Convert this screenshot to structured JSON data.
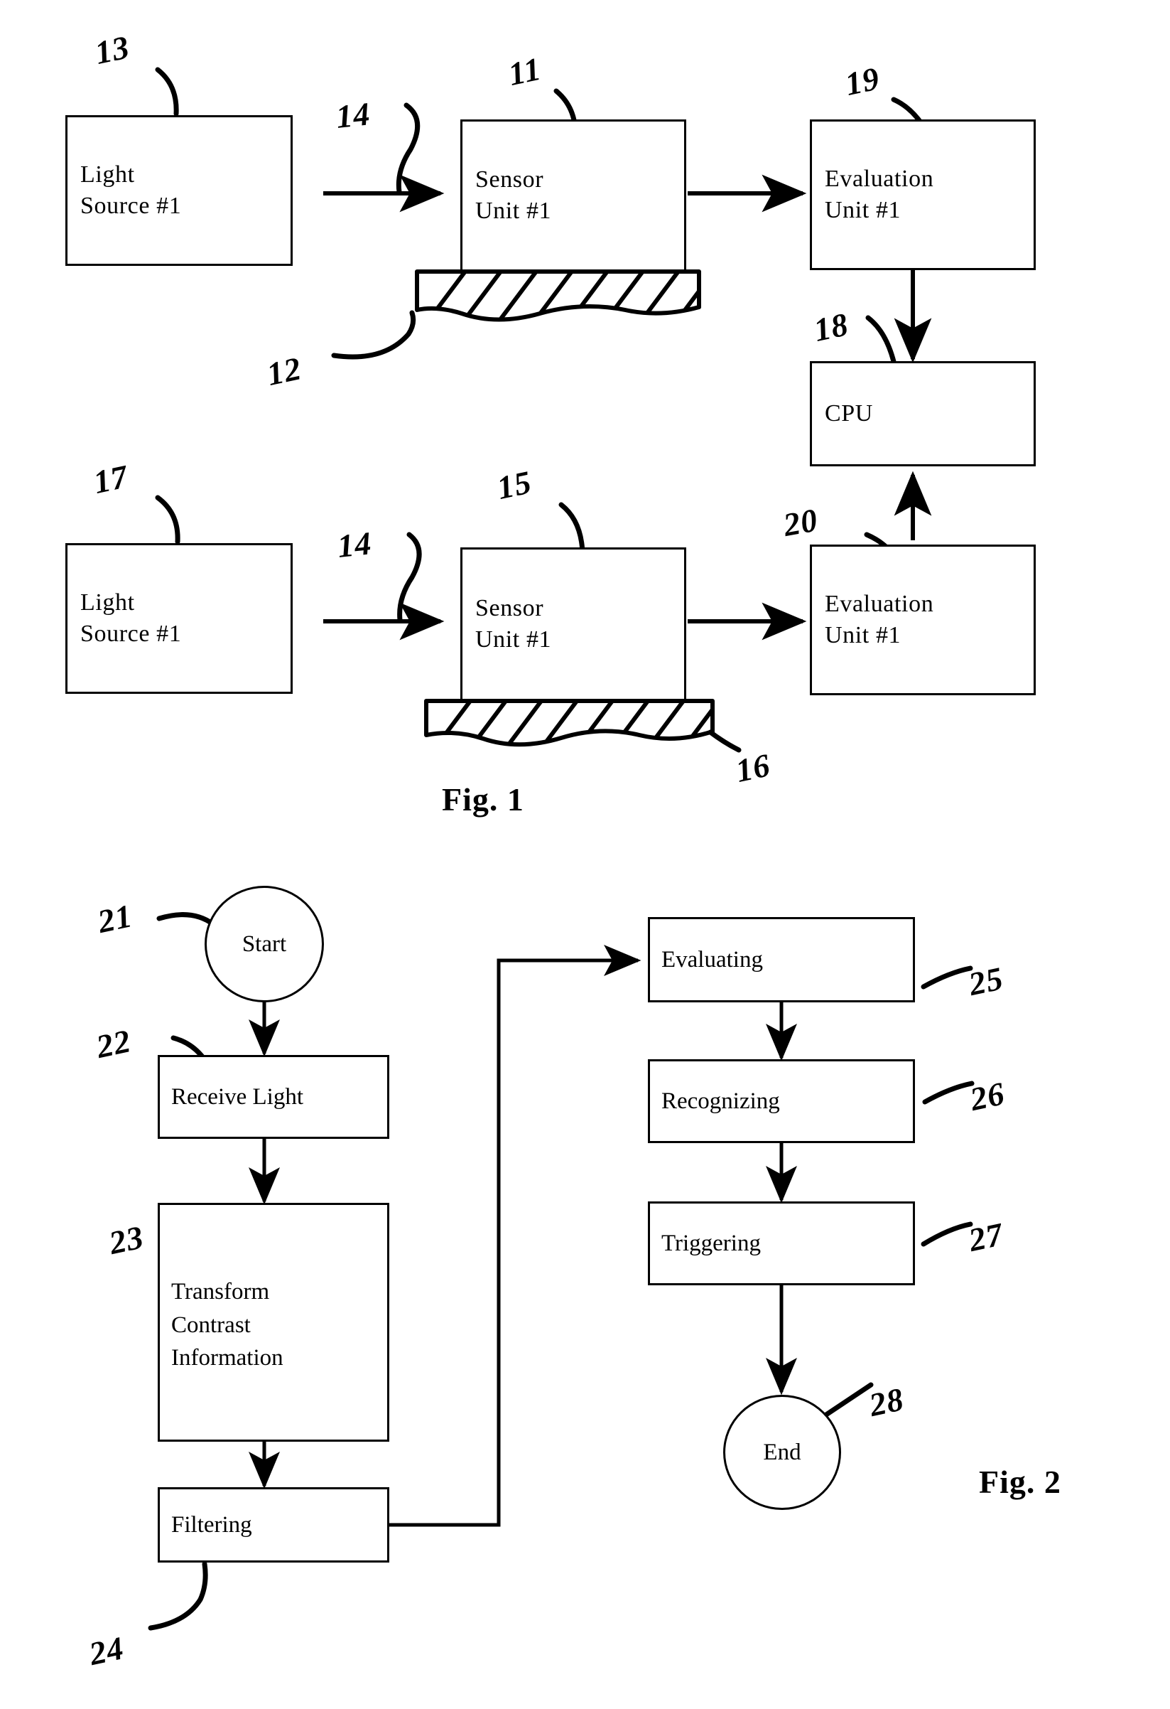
{
  "figure1": {
    "caption": "Fig. 1",
    "blocks": [
      {
        "id": "light-source-1",
        "lines": [
          "Light",
          "Source #1"
        ],
        "ref": "13"
      },
      {
        "id": "sensor-unit-1",
        "lines": [
          "Sensor",
          "Unit #1"
        ],
        "ref": "11"
      },
      {
        "id": "evaluation-unit-1",
        "lines": [
          "Evaluation",
          "Unit #1"
        ],
        "ref": "19"
      },
      {
        "id": "cpu",
        "lines": [
          "CPU"
        ],
        "ref": "18"
      },
      {
        "id": "light-source-2",
        "lines": [
          "Light",
          "Source #1"
        ],
        "ref": "17"
      },
      {
        "id": "sensor-unit-2",
        "lines": [
          "Sensor",
          "Unit #1"
        ],
        "ref": "15"
      },
      {
        "id": "evaluation-unit-2",
        "lines": [
          "Evaluation",
          "Unit #1"
        ],
        "ref": "20"
      }
    ],
    "beam_ref_top": "14",
    "beam_ref_bottom": "14",
    "surface_ref_top": "12",
    "surface_ref_bottom": "16"
  },
  "figure2": {
    "caption": "Fig. 2",
    "steps": [
      {
        "id": "start",
        "label": "Start",
        "ref": "21",
        "shape": "terminator"
      },
      {
        "id": "receive",
        "label": "Receive Light",
        "ref": "22",
        "shape": "process"
      },
      {
        "id": "transform",
        "lines": [
          "Transform",
          "Contrast",
          "Information"
        ],
        "ref": "23",
        "shape": "process"
      },
      {
        "id": "filtering",
        "label": "Filtering",
        "ref": "24",
        "shape": "process"
      },
      {
        "id": "evaluating",
        "label": "Evaluating",
        "ref": "25",
        "shape": "process"
      },
      {
        "id": "recognizing",
        "label": "Recognizing",
        "ref": "26",
        "shape": "process"
      },
      {
        "id": "triggering",
        "label": "Triggering",
        "ref": "27",
        "shape": "process"
      },
      {
        "id": "end",
        "label": "End",
        "ref": "28",
        "shape": "terminator"
      }
    ]
  },
  "colors": {
    "ink": "#000000",
    "paper": "#ffffff"
  }
}
